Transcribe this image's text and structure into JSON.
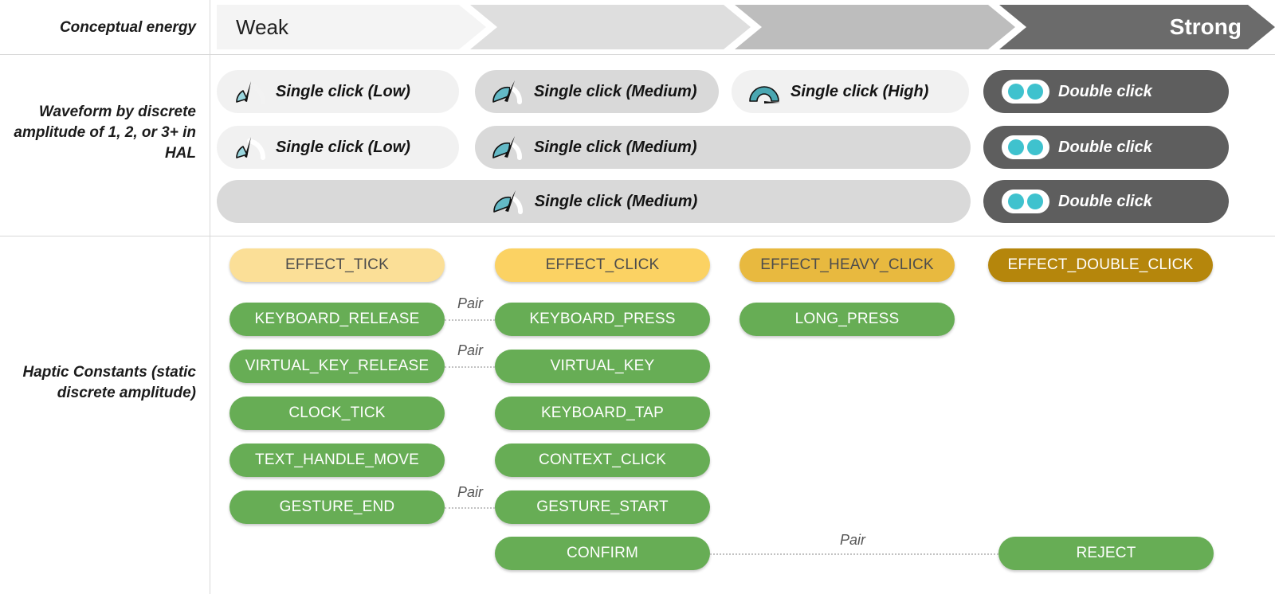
{
  "rows": {
    "energy_label": "Conceptual energy",
    "waveform_label": "Waveform by discrete amplitude of 1, 2, or 3+ in HAL",
    "constants_label": "Haptic Constants (static discrete amplitude)"
  },
  "energy": {
    "weak": "Weak",
    "strong": "Strong",
    "segments": [
      "#f4f4f4",
      "#dedede",
      "#bdbdbd",
      "#6b6b6b"
    ]
  },
  "waveform": {
    "rows": [
      {
        "cells": [
          {
            "label": "Single click (Low)",
            "icon": "gauge-low-icon",
            "tone": "light"
          },
          {
            "label": "Single click (Medium)",
            "icon": "gauge-medium-icon",
            "tone": "mid"
          },
          {
            "label": "Single click (High)",
            "icon": "gauge-high-icon",
            "tone": "light"
          },
          {
            "label": "Double click",
            "icon": "double-click-icon",
            "tone": "dark"
          }
        ]
      },
      {
        "cells": [
          {
            "label": "Single click (Low)",
            "icon": "gauge-low-icon",
            "tone": "light"
          },
          {
            "label": "Single click (Medium)",
            "icon": "gauge-medium-icon",
            "tone": "mid"
          },
          {
            "label": "Double click",
            "icon": "double-click-icon",
            "tone": "dark"
          }
        ]
      },
      {
        "cells": [
          {
            "label": "Single click (Medium)",
            "icon": "gauge-medium-icon",
            "tone": "mid"
          },
          {
            "label": "Double click",
            "icon": "double-click-icon",
            "tone": "dark"
          }
        ]
      }
    ]
  },
  "effects": [
    {
      "label": "EFFECT_TICK",
      "style": "tick"
    },
    {
      "label": "EFFECT_CLICK",
      "style": "click"
    },
    {
      "label": "EFFECT_HEAVY_CLICK",
      "style": "heavy"
    },
    {
      "label": "EFFECT_DOUBLE_CLICK",
      "style": "double"
    }
  ],
  "constants": {
    "col1": [
      "KEYBOARD_RELEASE",
      "VIRTUAL_KEY_RELEASE",
      "CLOCK_TICK",
      "TEXT_HANDLE_MOVE",
      "GESTURE_END"
    ],
    "col2": [
      "KEYBOARD_PRESS",
      "VIRTUAL_KEY",
      "KEYBOARD_TAP",
      "CONTEXT_CLICK",
      "GESTURE_START",
      "CONFIRM"
    ],
    "col3": [
      "LONG_PRESS"
    ],
    "col4": [
      "REJECT"
    ]
  },
  "pairs": [
    {
      "label": "Pair"
    },
    {
      "label": "Pair"
    },
    {
      "label": "Pair"
    },
    {
      "label": "Pair"
    }
  ],
  "colors": {
    "green": "#67ad55",
    "tick": "#fbdf97",
    "click": "#fbd263",
    "heavy": "#e8b93f",
    "double": "#b5860c",
    "teal": "#5fc5cf",
    "divider": "#d8d8d8"
  }
}
